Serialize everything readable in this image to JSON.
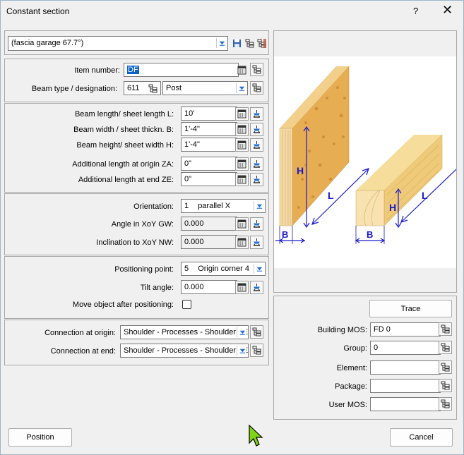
{
  "window": {
    "title": "Constant section",
    "help": "?",
    "close": "✕"
  },
  "preset": {
    "value": "(fascia garage 67.7°)"
  },
  "item_number": {
    "label": "Item number:",
    "value": "DF"
  },
  "beam_type": {
    "label": "Beam type / designation:",
    "code": "611",
    "value": "Post"
  },
  "beam_length": {
    "label": "Beam length/ sheet length L:",
    "value": "10'"
  },
  "beam_width": {
    "label": "Beam width / sheet thickn. B:",
    "value": "1'-4\""
  },
  "beam_height": {
    "label": "Beam height/ sheet width H:",
    "value": "1'-4\""
  },
  "add_origin": {
    "label": "Additional length at origin ZA:",
    "value": "0\""
  },
  "add_end": {
    "label": "Additional length at end ZE:",
    "value": "0\""
  },
  "orientation": {
    "label": "Orientation:",
    "code": "1",
    "value": "parallel X"
  },
  "angle_xoy": {
    "label": "Angle in XoY GW:",
    "value": "0.000"
  },
  "inclination": {
    "label": "Inclination to XoY NW:",
    "value": "0.000"
  },
  "positioning_point": {
    "label": "Positioning point:",
    "code": "5",
    "value": "Origin corner 4"
  },
  "tilt_angle": {
    "label": "Tilt angle:",
    "value": "0.000"
  },
  "move_after": {
    "label": "Move object after positioning:",
    "checked": false
  },
  "conn_origin": {
    "label": "Connection at origin:",
    "value": "Shoulder - Processes - Shoulder - E"
  },
  "conn_end": {
    "label": "Connection at end:",
    "value": "Shoulder - Processes - Shoulder - E"
  },
  "diagram": {
    "h": "H",
    "l": "L",
    "b": "B",
    "h2": "H",
    "l2": "L",
    "b2": "B"
  },
  "trace_button": "Trace",
  "building_mos": {
    "label": "Building MOS:",
    "value": "FD 0"
  },
  "group": {
    "label": "Group:",
    "value": "0"
  },
  "element": {
    "label": "Element:",
    "value": ""
  },
  "package": {
    "label": "Package:",
    "value": ""
  },
  "user_mos": {
    "label": "User MOS:",
    "value": ""
  },
  "position_button": "Position",
  "cancel_button": "Cancel",
  "colors": {
    "accent": "#0b63c7",
    "dimension": "#1a1acc",
    "wood_light": "#f3cd7a",
    "osb": "#e0a64c"
  }
}
